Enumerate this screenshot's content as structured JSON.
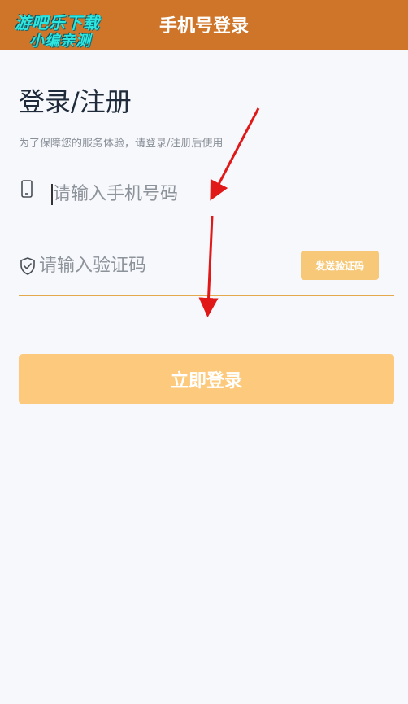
{
  "header": {
    "title": "手机号登录",
    "watermark_line1": "游吧乐下载",
    "watermark_line2": "小编亲测"
  },
  "main": {
    "title": "登录/注册",
    "subtitle": "为了保障您的服务体验，请登录/注册后使用"
  },
  "phone_field": {
    "icon": "phone-icon",
    "placeholder": "请输入手机号码",
    "value": ""
  },
  "code_field": {
    "icon": "shield-check-icon",
    "placeholder": "请输入验证码",
    "value": "",
    "send_button_label": "发送验证码"
  },
  "login_button": {
    "label": "立即登录"
  },
  "colors": {
    "header_bg": "#cf7529",
    "accent": "#fdca7d",
    "underline": "#e3a94c",
    "annotation_arrow": "#e01818",
    "watermark": "#2ee6e0"
  }
}
